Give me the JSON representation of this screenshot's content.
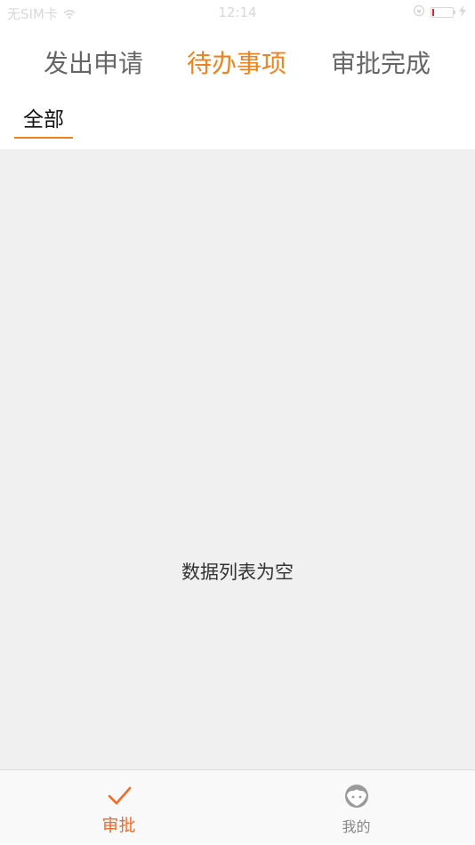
{
  "status_bar": {
    "carrier": "无SIM卡",
    "time": "12:14",
    "battery_level": 0.05,
    "colors": {
      "battery_low": "#e8202a"
    }
  },
  "header": {
    "tabs": [
      {
        "label": "发出申请",
        "active": false
      },
      {
        "label": "待办事项",
        "active": true
      },
      {
        "label": "审批完成",
        "active": false
      }
    ],
    "filter": {
      "label": "全部"
    },
    "colors": {
      "accent": "#f0821e",
      "inactive": "#666666"
    }
  },
  "main": {
    "empty_message": "数据列表为空"
  },
  "bottom_nav": {
    "items": [
      {
        "label": "审批",
        "icon": "check-icon",
        "active": true
      },
      {
        "label": "我的",
        "icon": "face-icon",
        "active": false
      }
    ],
    "colors": {
      "active": "#f06a2a",
      "inactive": "#888888"
    }
  }
}
